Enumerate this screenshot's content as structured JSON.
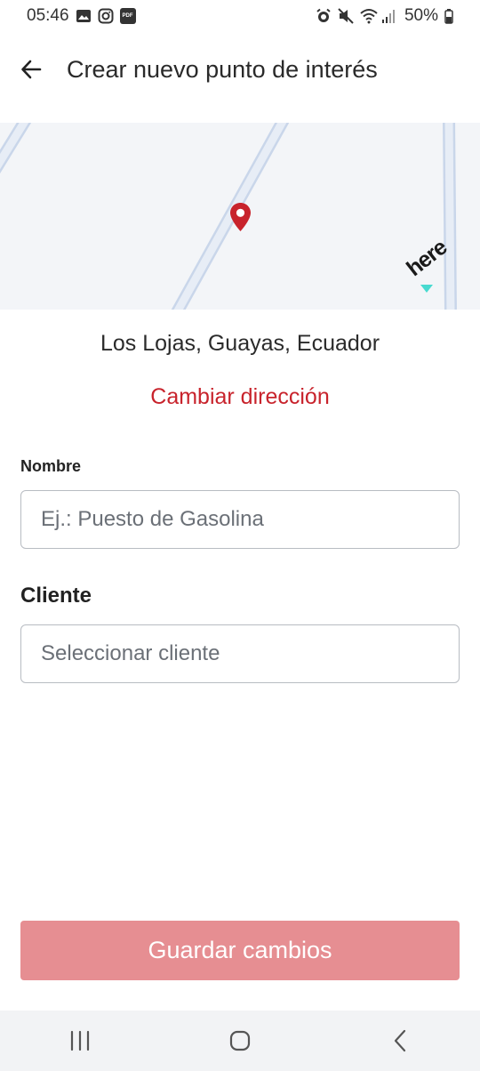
{
  "status_bar": {
    "time": "05:46",
    "battery_percent": "50%",
    "icons": [
      "image-icon",
      "instagram-icon",
      "pdf-icon",
      "alarm-icon",
      "mute-icon",
      "wifi-icon",
      "signal-icon",
      "battery-icon"
    ]
  },
  "header": {
    "title": "Crear nuevo punto de interés",
    "back_icon": "arrow-left-icon"
  },
  "map": {
    "provider_logo": "here",
    "pin_color": "#c8232c",
    "road_color": "#c9d6ea"
  },
  "location": {
    "address": "Los Lojas, Guayas, Ecuador",
    "change_label": "Cambiar dirección"
  },
  "form": {
    "name_label": "Nombre",
    "name_placeholder": "Ej.: Puesto de Gasolina",
    "name_value": "",
    "client_label": "Cliente",
    "client_placeholder": "Seleccionar cliente"
  },
  "actions": {
    "save_label": "Guardar cambios"
  },
  "nav": {
    "recents_icon": "recents-icon",
    "home_icon": "home-icon",
    "back_icon": "back-chevron-icon"
  },
  "colors": {
    "accent": "#c8232c",
    "save_button": "#e68e92",
    "nav_bg": "#f2f3f5",
    "map_bg": "#f3f5f8"
  }
}
